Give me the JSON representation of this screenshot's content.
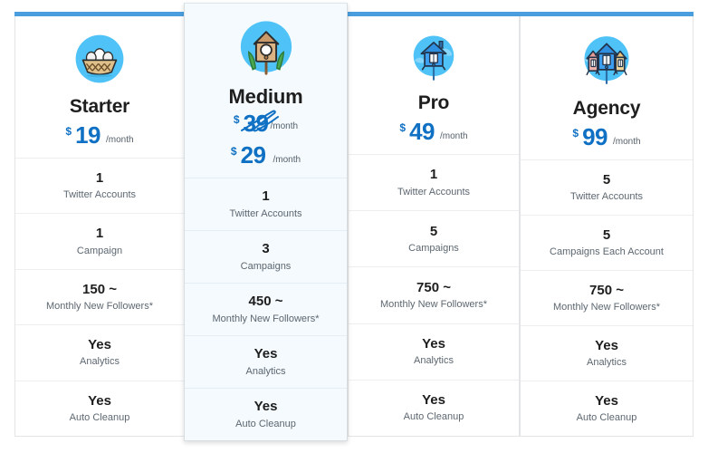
{
  "accent": {
    "topbar": "#4a9ede",
    "price": "#1071c4",
    "featured_bg": "#f4fafd",
    "icon_circle": "#4fc3f7"
  },
  "plans": [
    {
      "id": "starter",
      "name": "Starter",
      "icon": "nest-basket-eggs-icon",
      "featured": false,
      "currency": "$",
      "price": "19",
      "period": "/month",
      "features": [
        {
          "value": "1",
          "label": "Twitter Accounts"
        },
        {
          "value": "1",
          "label": "Campaign"
        },
        {
          "value": "150 ~",
          "label": "Monthly New Followers*"
        },
        {
          "value": "Yes",
          "label": "Analytics"
        },
        {
          "value": "Yes",
          "label": "Auto Cleanup"
        }
      ]
    },
    {
      "id": "medium",
      "name": "Medium",
      "icon": "birdhouse-leaves-icon",
      "featured": true,
      "currency": "$",
      "old_currency": "$",
      "old_price": "39",
      "old_period": "/month",
      "price": "29",
      "period": "/month",
      "features": [
        {
          "value": "1",
          "label": "Twitter Accounts"
        },
        {
          "value": "3",
          "label": "Campaigns"
        },
        {
          "value": "450 ~",
          "label": "Monthly New Followers*"
        },
        {
          "value": "Yes",
          "label": "Analytics"
        },
        {
          "value": "Yes",
          "label": "Auto Cleanup"
        }
      ]
    },
    {
      "id": "pro",
      "name": "Pro",
      "icon": "blue-birdhouse-pole-icon",
      "featured": false,
      "currency": "$",
      "price": "49",
      "period": "/month",
      "features": [
        {
          "value": "1",
          "label": "Twitter Accounts"
        },
        {
          "value": "5",
          "label": "Campaigns"
        },
        {
          "value": "750 ~",
          "label": "Monthly New Followers*"
        },
        {
          "value": "Yes",
          "label": "Analytics"
        },
        {
          "value": "Yes",
          "label": "Auto Cleanup"
        }
      ]
    },
    {
      "id": "agency",
      "name": "Agency",
      "icon": "three-birdhouses-icon",
      "featured": false,
      "currency": "$",
      "price": "99",
      "period": "/month",
      "features": [
        {
          "value": "5",
          "label": "Twitter Accounts"
        },
        {
          "value": "5",
          "label": "Campaigns Each Account"
        },
        {
          "value": "750 ~",
          "label": "Monthly New Followers*"
        },
        {
          "value": "Yes",
          "label": "Analytics"
        },
        {
          "value": "Yes",
          "label": "Auto Cleanup"
        }
      ]
    }
  ]
}
